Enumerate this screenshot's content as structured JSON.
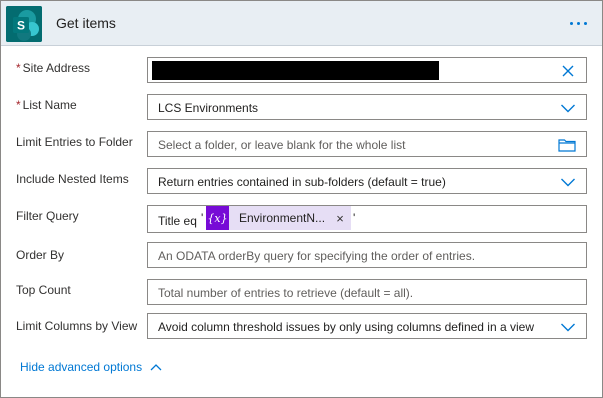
{
  "header": {
    "title": "Get items",
    "icon_letter": "S",
    "brand_color": "#036c70"
  },
  "fields": {
    "site_address": {
      "label": "Site Address",
      "required": true,
      "value_redacted": true
    },
    "list_name": {
      "label": "List Name",
      "required": true,
      "value": "LCS Environments"
    },
    "limit_folder": {
      "label": "Limit Entries to Folder",
      "placeholder": "Select a folder, or leave blank for the whole list"
    },
    "include_nested": {
      "label": "Include Nested Items",
      "value": "Return entries contained in sub-folders (default = true)"
    },
    "filter_query": {
      "label": "Filter Query",
      "prefix": "Title eq",
      "quote_open": "'",
      "quote_close": "'",
      "token": {
        "icon_text": "{x}",
        "label": "EnvironmentN...",
        "remove": "×",
        "color": "#770bd6"
      }
    },
    "order_by": {
      "label": "Order By",
      "placeholder": "An ODATA orderBy query for specifying the order of entries."
    },
    "top_count": {
      "label": "Top Count",
      "placeholder": "Total number of entries to retrieve (default = all)."
    },
    "limit_columns": {
      "label": "Limit Columns by View",
      "value": "Avoid column threshold issues by only using columns defined in a view"
    }
  },
  "footer": {
    "advanced_link": "Hide advanced options"
  },
  "icons": {
    "more": "more-icon",
    "clear": "clear-icon",
    "chevron": "chevron-down-icon",
    "folder": "folder-icon",
    "chevron_up": "chevron-up-icon"
  },
  "colors": {
    "accent": "#0078d4",
    "required": "#a4262c",
    "header_bg": "#e8eef3"
  }
}
